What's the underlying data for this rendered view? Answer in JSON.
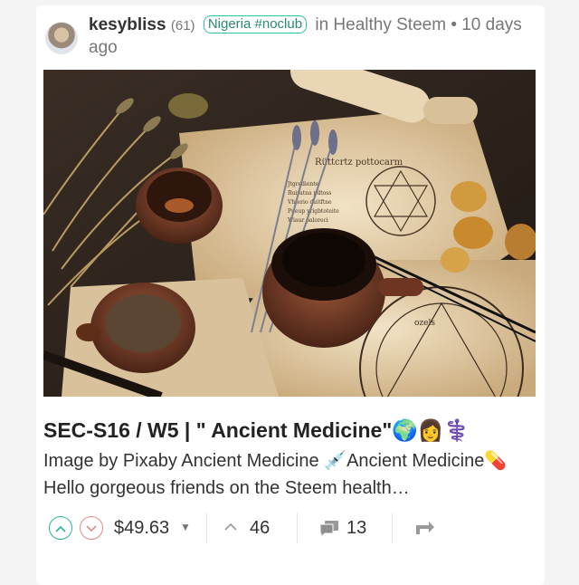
{
  "post": {
    "author": "kesybliss",
    "reputation": "(61)",
    "community_tag": "Nigeria #noclub",
    "in_text": "in Healthy Steem",
    "time": "• 10 days ago",
    "title": "SEC-S16 / W5 | \" Ancient Medicine\"🌍👩⚕️",
    "excerpt_line1": "Image by Pixaby Ancient Medicine 💉Ancient Medicine💊",
    "excerpt_line2": "Hello gorgeous friends on the Steem health…"
  },
  "thumbnail": {
    "scroll_heading": "Rüttcrtz pottocarm",
    "scroll_lines": [
      "Jtgrediente",
      "Ruiratna pdtoss",
      "Vhterio duitftne",
      "Pueup yrigbtoteite",
      "Wiaur paloreci"
    ],
    "map_text": "ozels"
  },
  "stats": {
    "payout": "$49.63",
    "votes": "46",
    "comments": "13"
  },
  "colors": {
    "accent": "#27b89a",
    "downvote": "#e58a8a"
  },
  "icons": {
    "upvote": "chevron-up-circle-icon",
    "downvote": "chevron-down-circle-icon",
    "payout_dropdown": "caret-down-icon",
    "votes": "chevron-up-icon",
    "comments": "comment-bubble-icon",
    "resteem": "resteem-icon"
  }
}
